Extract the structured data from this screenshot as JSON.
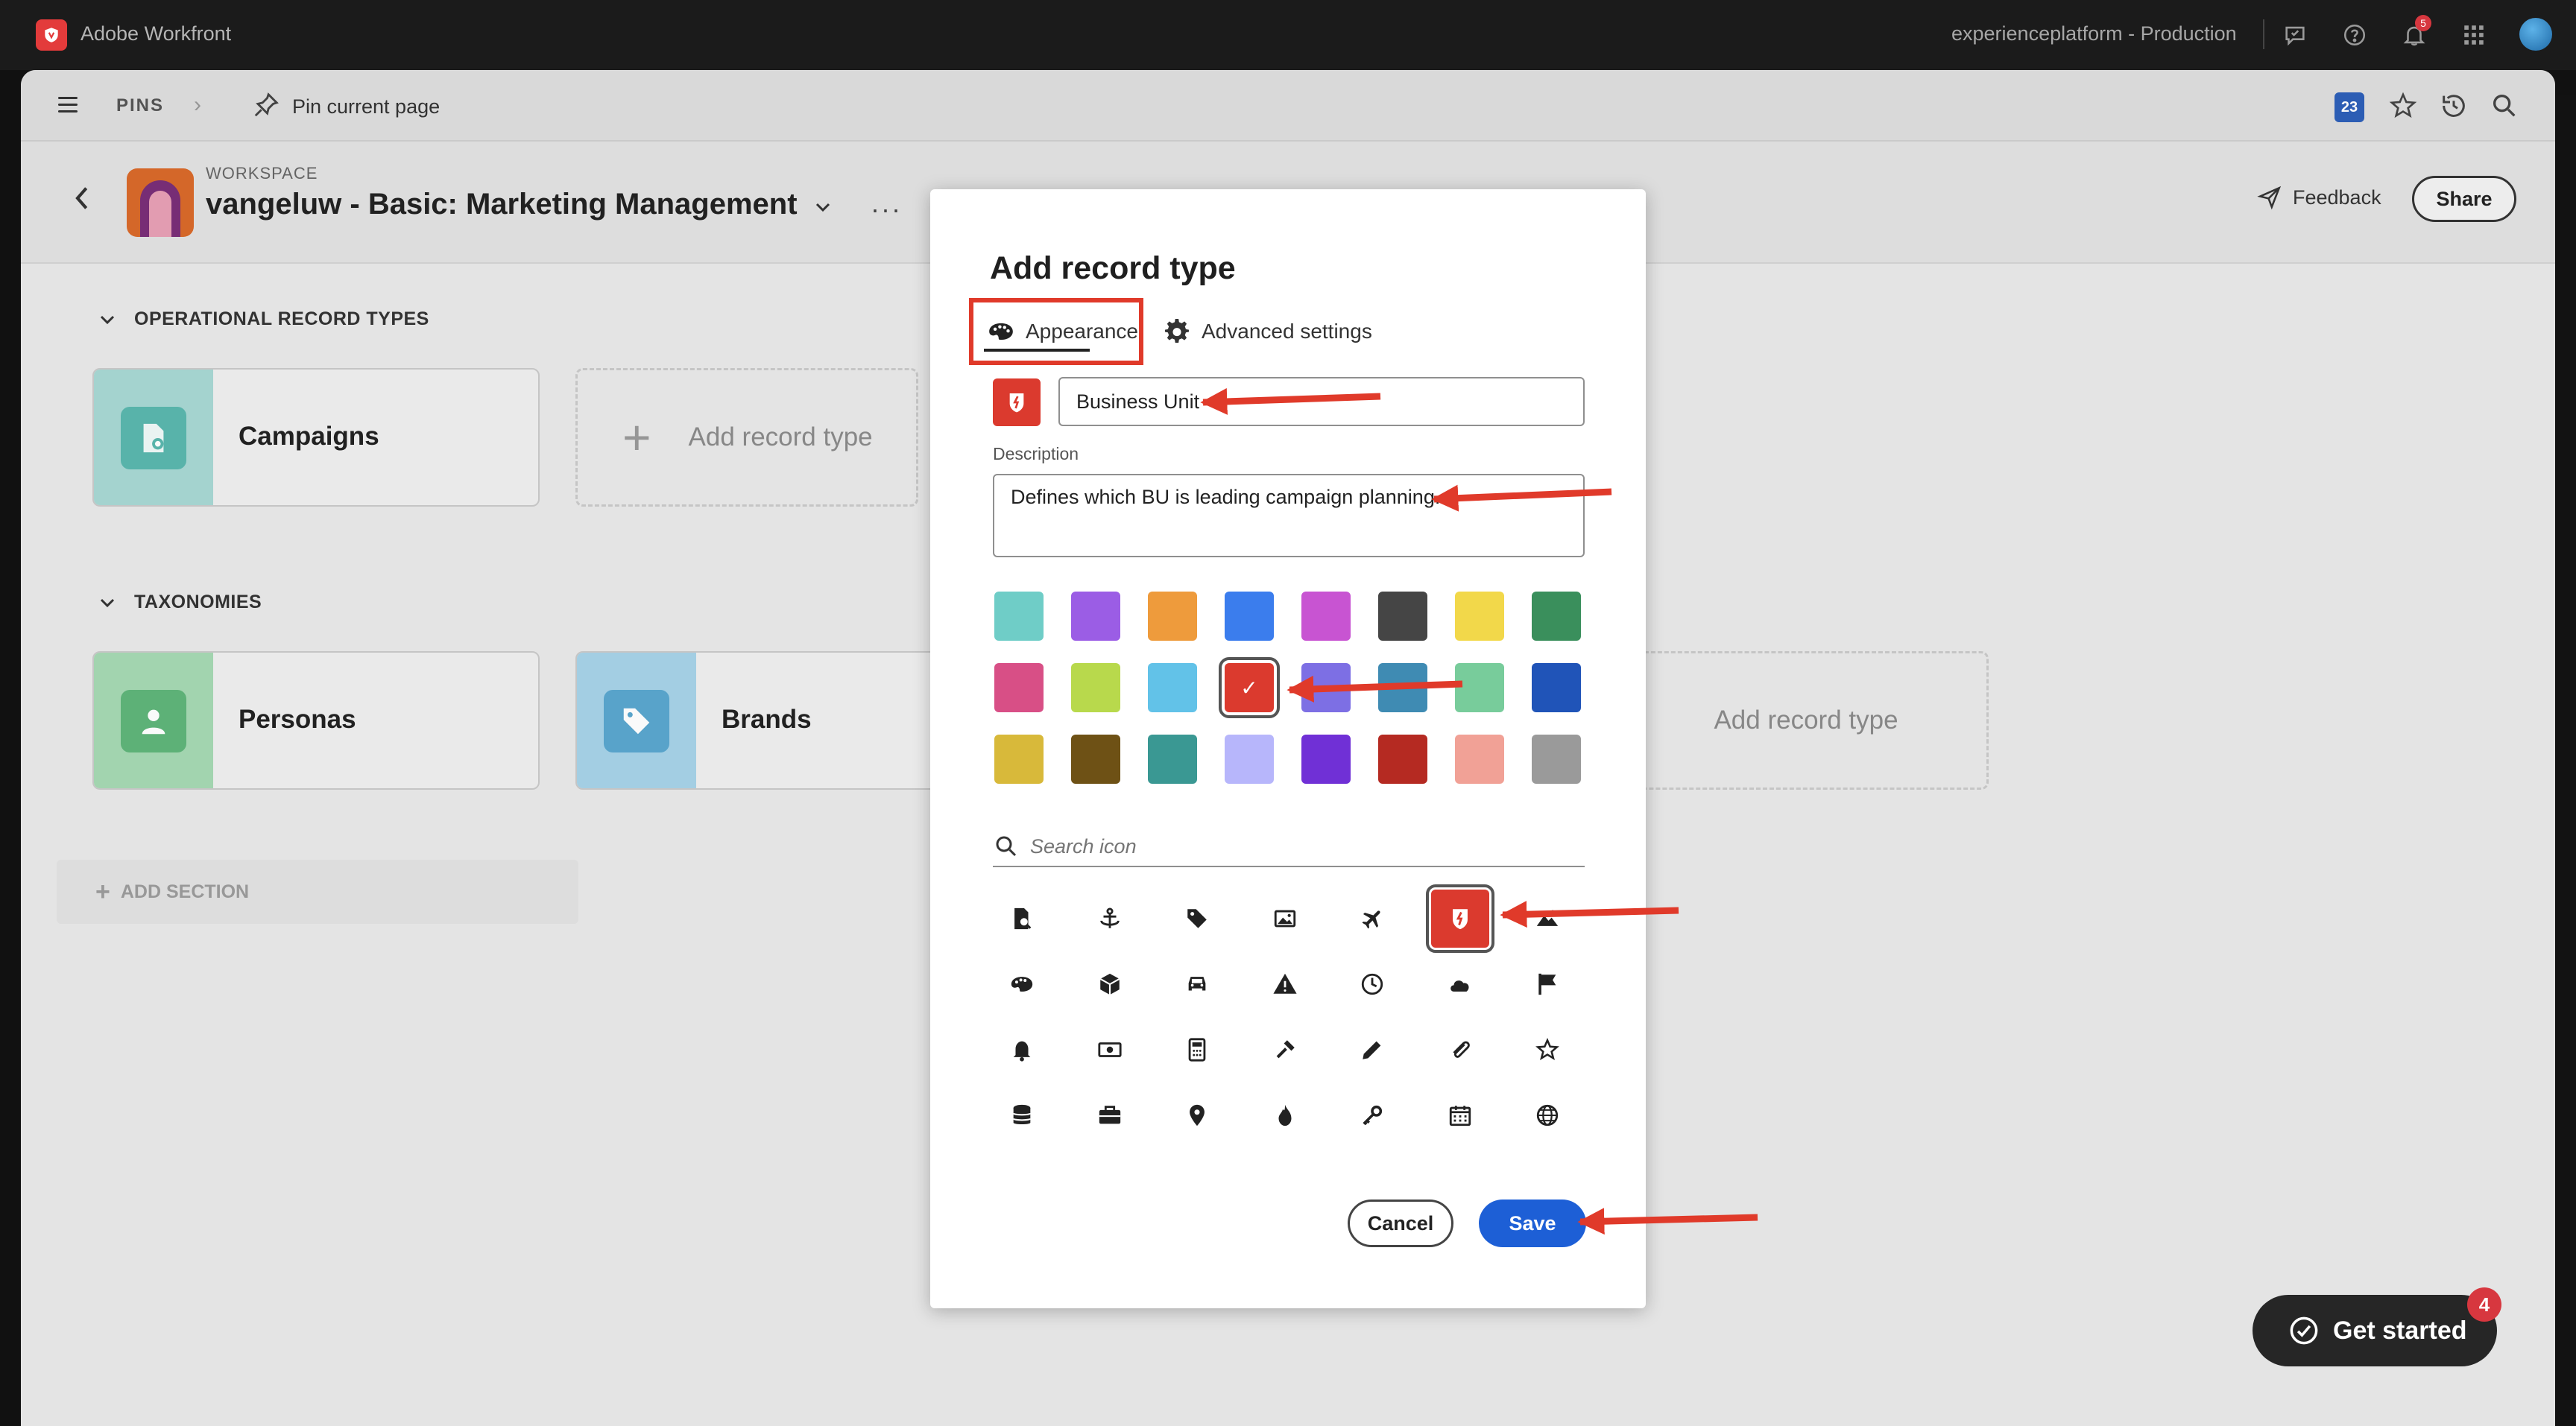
{
  "app": {
    "name": "Adobe Workfront",
    "environment": "experienceplatform - Production",
    "notification_count": "5"
  },
  "pins_bar": {
    "label": "PINS",
    "pin_current_page": "Pin current page",
    "calendar_badge": "23"
  },
  "workspace": {
    "kicker": "WORKSPACE",
    "title": "vangeluw - Basic: Marketing Management",
    "more": "···",
    "feedback": "Feedback",
    "share": "Share"
  },
  "sections": {
    "operational": {
      "title": "OPERATIONAL RECORD TYPES",
      "cards": [
        {
          "name": "Campaigns",
          "icon": "document-gear-icon"
        }
      ],
      "add_label": "Add record type"
    },
    "taxonomies": {
      "title": "TAXONOMIES",
      "cards": [
        {
          "name": "Personas",
          "icon": "person-icon"
        },
        {
          "name": "Brands",
          "icon": "tag-icon"
        }
      ],
      "add_label": "Add record type"
    },
    "add_section": "ADD SECTION"
  },
  "modal": {
    "title": "Add record type",
    "tabs": [
      {
        "label": "Appearance",
        "icon": "palette-icon",
        "active": true
      },
      {
        "label": "Advanced settings",
        "icon": "gear-icon",
        "active": false
      }
    ],
    "name_value": "Business Unit",
    "description_label": "Description",
    "description_value": "Defines which BU is leading campaign planning.",
    "selected_color": "#db3a2e",
    "colors": [
      "#6fcdc7",
      "#9b5de5",
      "#ee9b3c",
      "#3b7ded",
      "#c854d2",
      "#454545",
      "#f2d84a",
      "#3a8f5c",
      "#d84f86",
      "#b8d94c",
      "#62c2e8",
      "#db3a2e",
      "#7d6fe4",
      "#3f8bb3",
      "#78cc9b",
      "#2054b8",
      "#d8b93a",
      "#6e5115",
      "#3a9893",
      "#b7b6fb",
      "#7030d6",
      "#b52a22",
      "#f1a196",
      "#9a9a9a"
    ],
    "selected_color_index": 11,
    "search_placeholder": "Search icon",
    "icons": [
      "document-search-icon",
      "anchor-icon",
      "tag-icon",
      "image-icon",
      "airplane-icon",
      "shield-icon",
      "landscape-icon",
      "palette-icon",
      "box-icon",
      "car-icon",
      "warning-icon",
      "clock-icon",
      "cloud-icon",
      "flag-icon",
      "bell-icon",
      "money-icon",
      "calculator-icon",
      "hammer-icon",
      "pencil-icon",
      "paperclip-icon",
      "star-icon",
      "database-icon",
      "briefcase-icon",
      "location-pin-icon",
      "flame-icon",
      "key-icon",
      "calendar-icon",
      "globe-icon"
    ],
    "selected_icon_index": 5,
    "cancel": "Cancel",
    "save": "Save"
  },
  "get_started": {
    "label": "Get started",
    "badge": "4"
  },
  "colors": {
    "annotation_red": "#e03a2a",
    "primary_blue": "#1d5fd6"
  }
}
